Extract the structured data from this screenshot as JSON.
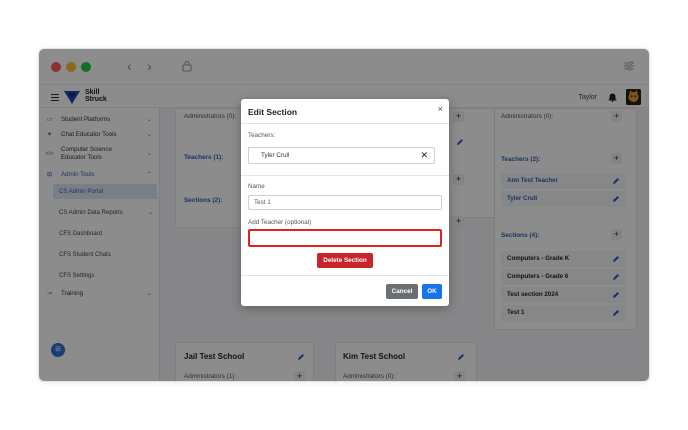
{
  "browser": {
    "back_glyph": "‹",
    "forward_glyph": "›",
    "icons": [
      "lock-icon",
      "sliders-icon"
    ]
  },
  "header": {
    "logo_line1": "Skill",
    "logo_line2": "Struck",
    "username": "Taylor"
  },
  "sidebar": {
    "items": [
      {
        "label": "Student Platforms",
        "icon": "▭"
      },
      {
        "label": "Chat Educator Tools",
        "icon": "✦"
      },
      {
        "label": "Computer Science Educator Tools",
        "icon": "</>"
      },
      {
        "label": "Admin Tools",
        "icon": "⊞"
      },
      {
        "label": "Training",
        "icon": "⊸"
      }
    ],
    "sub_items": [
      {
        "label": "CS Admin Portal"
      },
      {
        "label": "CS Admin Data Reports"
      },
      {
        "label": "CFS Dashboard"
      },
      {
        "label": "CFS Student Chats"
      },
      {
        "label": "CFS Settings"
      }
    ],
    "fab_icon": "⊞"
  },
  "main": {
    "left_card": {
      "administrators": "Administrators (0):",
      "teachers": "Teachers (1):",
      "sections": "Sections (2):"
    },
    "right_card": {
      "administrators": "Administrators (0):",
      "teachers_heading": "Teachers (2):",
      "teachers": [
        "Ann Test Teacher",
        "Tyler Crull"
      ],
      "sections_heading": "Sections (4):",
      "sections": [
        "Computers - Grade K",
        "Computers - Grade 6",
        "Test section 2024",
        "Test 1"
      ]
    },
    "bottom_cards": [
      {
        "title": "Jail Test School",
        "administrators": "Administrators (1):"
      },
      {
        "title": "Kim Test School",
        "administrators": "Administrators (0):"
      }
    ]
  },
  "modal": {
    "title": "Edit Section",
    "close": "×",
    "teachers_label": "Teachers:",
    "teacher_chip": "Tyler Crull",
    "chip_remove": "✕",
    "name_label": "Name",
    "name_value": "Test 1",
    "add_teacher_label": "Add Teacher (optional)",
    "add_teacher_value": "",
    "delete_label": "Delete Section",
    "cancel_label": "Cancel",
    "ok_label": "OK"
  },
  "colors": {
    "accent": "#1a73e8",
    "danger": "#c8242b",
    "highlight": "#e0231a",
    "link": "#2d5fb0"
  }
}
